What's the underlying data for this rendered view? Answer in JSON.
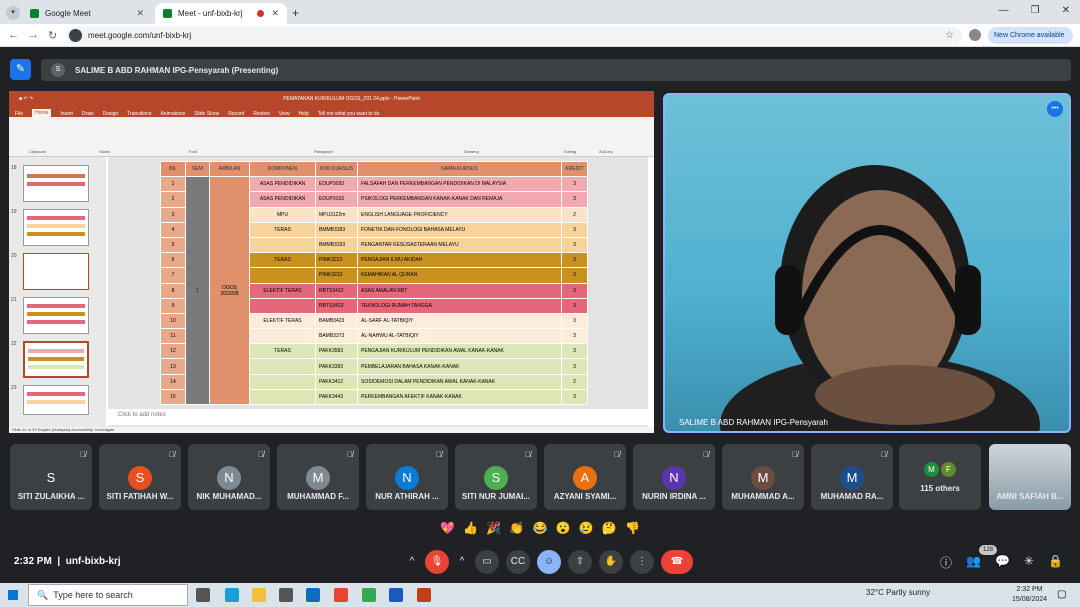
{
  "browser": {
    "tabs": [
      {
        "title": "Google Meet",
        "active": false
      },
      {
        "title": "Meet - unf-bixb-krj",
        "active": true
      }
    ],
    "url": "meet.google.com/unf-bixb-krj",
    "chrome_badge": "New Chrome available"
  },
  "meet": {
    "presenter_initial": "S",
    "presenter_bar": "SALIME B ABD RAHMAN IPG-Pensyarah (Presenting)",
    "camera_label": "SALIME B ABD RAHMAN IPG-Pensyarah",
    "time": "2:32 PM",
    "meeting_code": "unf-bixb-krj",
    "participant_count": "128",
    "others_label": "115 others",
    "participants": [
      {
        "initial": "S",
        "name": "SITI ZULAIKHA ...",
        "color": "#3c4043"
      },
      {
        "initial": "S",
        "name": "SITI FATIHAH W...",
        "color": "#e8501f"
      },
      {
        "initial": "N",
        "name": "NIK MUHAMAD...",
        "color": "#7d8a93"
      },
      {
        "initial": "M",
        "name": "MUHAMMAD F...",
        "color": "#7d8a93"
      },
      {
        "initial": "N",
        "name": "NUR ATHIRAH ...",
        "color": "#0b7bd6"
      },
      {
        "initial": "S",
        "name": "SITI NUR JUMAI...",
        "color": "#4caf50"
      },
      {
        "initial": "A",
        "name": "AZYANI SYAMI...",
        "color": "#e8700f"
      },
      {
        "initial": "N",
        "name": "NURIN IRDINA ...",
        "color": "#5b35b0"
      },
      {
        "initial": "M",
        "name": "MUHAMMAD A...",
        "color": "#6d4c41"
      },
      {
        "initial": "M",
        "name": "MUHAMAD RA...",
        "color": "#1a4f8b"
      }
    ],
    "last_tile_name": "AMNI SAFIAH B...",
    "reactions": [
      "💖",
      "👍",
      "🎉",
      "👏",
      "😂",
      "😮",
      "😢",
      "🤔",
      "👎"
    ]
  },
  "ppt": {
    "title": "PEMATAKAN KURIKULUM OGOS_Z01 24.pptx - PowerPoint",
    "tabs": [
      "File",
      "Home",
      "Insert",
      "Draw",
      "Design",
      "Transitions",
      "Animations",
      "Slide Show",
      "Record",
      "Review",
      "View",
      "Help",
      "Tell me what you want to do"
    ],
    "ribbon_groups": [
      "Clipboard",
      "Slides",
      "Font",
      "Paragraph",
      "Drawing",
      "Editing",
      "Add-ins"
    ],
    "notes": "Click to add notes",
    "status": "Slide 22 of 33    English (Malaysia)    Accessibility: Investigate",
    "thumb_numbers": [
      "18",
      "19",
      "20",
      "21",
      "22",
      "23"
    ],
    "headers": [
      "BIL",
      "SEM",
      "AMBILAN",
      "KOMPONEN",
      "KOD KURSUS",
      "NAMA KURSUS",
      "KREDIT"
    ],
    "sem": "1",
    "ambilan": "OGOS 2023/28",
    "rows": [
      {
        "bil": "1",
        "komp": "ASAS PENDIDIKAN",
        "kod": "EDUP3093",
        "nama": "FALSAFAH DAN PERKEMBANGAN PENDIDIKAN DI MALAYSIA",
        "kredit": "3",
        "c": "#f2a9b0"
      },
      {
        "bil": "2",
        "komp": "ASAS PENDIDIKAN",
        "kod": "EDUP3103",
        "nama": "PSIKOLOGI PERKEMBANGAN KANAK-KANAK DAN REMAJA",
        "kredit": "3",
        "c": "#f2a9b0"
      },
      {
        "bil": "3",
        "komp": "MPU",
        "kod": "MPU3122m",
        "nama": "ENGLISH LANGUAGE PROFICIENCY",
        "kredit": "2",
        "c": "#fbe3c8"
      },
      {
        "bil": "4",
        "komp": "TERAS",
        "kod": "BMMB3183",
        "nama": "FONETIK DAN FONOLOGI BAHASA MELAYU",
        "kredit": "3",
        "c": "#f6d39b"
      },
      {
        "bil": "5",
        "komp": "",
        "kod": "BMMB3193",
        "nama": "PENGANTAR KESUSASTERAAN MELAYU",
        "kredit": "3",
        "c": "#f6d39b"
      },
      {
        "bil": "6",
        "komp": "TERAS",
        "kod": "PIMK3223",
        "nama": "PENGAJIAN ILMU AKIDAH",
        "kredit": "3",
        "c": "#c9911f"
      },
      {
        "bil": "7",
        "komp": "",
        "kod": "PIMK3233",
        "nama": "KEMAHIRAN AL QURAN",
        "kredit": "3",
        "c": "#c9911f"
      },
      {
        "bil": "8",
        "komp": "ELEKTIF TERAS",
        "kod": "RBTS3413",
        "nama": "ASAS AMALAN RBT",
        "kredit": "3",
        "c": "#e4677a"
      },
      {
        "bil": "9",
        "komp": "",
        "kod": "RBTS3423",
        "nama": "TEKNOLOGI RUMAH TANGGA",
        "kredit": "3",
        "c": "#e4677a"
      },
      {
        "bil": "10",
        "komp": "ELEKTIF TERAS",
        "kod": "BAMB3423",
        "nama": "AL-SARF AL-TATBIQIY",
        "kredit": "3",
        "c": "#fcecd9"
      },
      {
        "bil": "11",
        "komp": "",
        "kod": "BAMB3373",
        "nama": "AL-NAHWU AL-TATBIQIY",
        "kredit": "3",
        "c": "#fcecd9"
      },
      {
        "bil": "12",
        "komp": "TERAS",
        "kod": "PAKK3583",
        "nama": "PENGAJIAN KURIKULUM PENDIDIKAN AWAL KANAK-KANAK",
        "kredit": "3",
        "c": "#dde6b6"
      },
      {
        "bil": "13",
        "komp": "",
        "kod": "PAKK3393",
        "nama": "PEMBELAJARAN BAHASA KANAK-KANAK",
        "kredit": "3",
        "c": "#dde6b6"
      },
      {
        "bil": "14",
        "komp": "",
        "kod": "PAKK3412",
        "nama": "SOSIOEMOSI DALAM PENDIDIKAN AWAL KANAK-KANAK",
        "kredit": "2",
        "c": "#dde6b6"
      },
      {
        "bil": "15",
        "komp": "",
        "kod": "PAKK3443",
        "nama": "PERKEMBANGAN AFEKTIF KANAK-KANAK",
        "kredit": "3",
        "c": "#dde6b6"
      }
    ]
  },
  "taskbar": {
    "search_placeholder": "Type here to search",
    "weather": "32°C  Partly sunny",
    "time": "2:32 PM",
    "date": "15/08/2024"
  }
}
